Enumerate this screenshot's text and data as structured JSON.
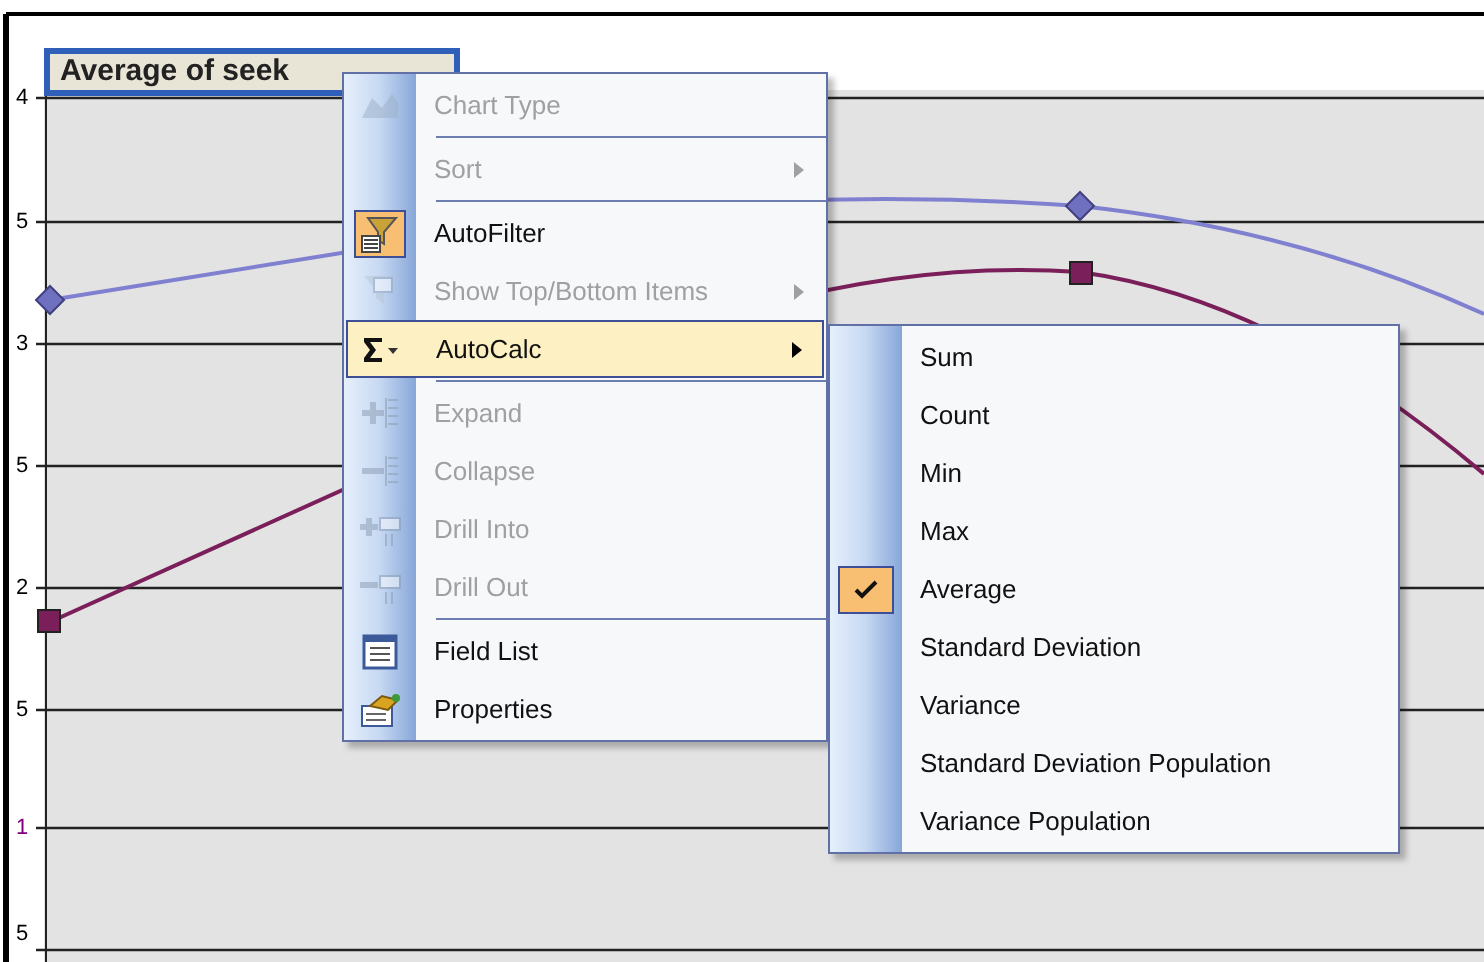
{
  "chart": {
    "title": "Average of seek",
    "axis_labels": [
      {
        "text": "4",
        "color": "#000000"
      },
      {
        "text": "5",
        "color": "#000000"
      },
      {
        "text": "3",
        "color": "#000000"
      },
      {
        "text": "5",
        "color": "#000000"
      },
      {
        "text": "2",
        "color": "#000000"
      },
      {
        "text": "5",
        "color": "#000000"
      },
      {
        "text": "1",
        "color": "#800080"
      },
      {
        "text": "5",
        "color": "#000000"
      }
    ]
  },
  "context_menu": {
    "items": [
      {
        "kind": "item",
        "label": "Chart Type",
        "disabled": true,
        "submenu": false,
        "selected": false,
        "checked": false
      },
      {
        "kind": "separator"
      },
      {
        "kind": "item",
        "label": "Sort",
        "disabled": true,
        "submenu": true,
        "selected": false,
        "checked": false
      },
      {
        "kind": "separator"
      },
      {
        "kind": "item",
        "label": "AutoFilter",
        "disabled": false,
        "submenu": false,
        "selected": false,
        "checked": true
      },
      {
        "kind": "item",
        "label": "Show Top/Bottom Items",
        "disabled": true,
        "submenu": true,
        "selected": false,
        "checked": false
      },
      {
        "kind": "item",
        "label": "AutoCalc",
        "disabled": false,
        "submenu": true,
        "selected": true,
        "checked": false
      },
      {
        "kind": "separator"
      },
      {
        "kind": "item",
        "label": "Expand",
        "disabled": true,
        "submenu": false,
        "selected": false,
        "checked": false
      },
      {
        "kind": "item",
        "label": "Collapse",
        "disabled": true,
        "submenu": false,
        "selected": false,
        "checked": false
      },
      {
        "kind": "item",
        "label": "Drill Into",
        "disabled": true,
        "submenu": false,
        "selected": false,
        "checked": false
      },
      {
        "kind": "item",
        "label": "Drill Out",
        "disabled": true,
        "submenu": false,
        "selected": false,
        "checked": false
      },
      {
        "kind": "separator"
      },
      {
        "kind": "item",
        "label": "Field List",
        "disabled": false,
        "submenu": false,
        "selected": false,
        "checked": false
      },
      {
        "kind": "item",
        "label": "Properties",
        "disabled": false,
        "submenu": false,
        "selected": false,
        "checked": false
      }
    ]
  },
  "autocalc_submenu": {
    "items": [
      {
        "label": "Sum",
        "checked": false
      },
      {
        "label": "Count",
        "checked": false
      },
      {
        "label": "Min",
        "checked": false
      },
      {
        "label": "Max",
        "checked": false
      },
      {
        "label": "Average",
        "checked": true
      },
      {
        "label": "Standard Deviation",
        "checked": false
      },
      {
        "label": "Variance",
        "checked": false
      },
      {
        "label": "Standard Deviation Population",
        "checked": false
      },
      {
        "label": "Variance Population",
        "checked": false
      }
    ]
  }
}
